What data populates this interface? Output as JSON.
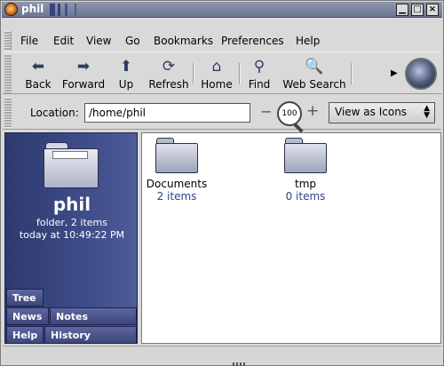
{
  "window": {
    "title": "phil"
  },
  "menu": {
    "items": [
      "File",
      "Edit",
      "View",
      "Go",
      "Bookmarks",
      "Preferences",
      "Help"
    ]
  },
  "toolbar": {
    "buttons": [
      {
        "label": "Back",
        "icon": "back-arrow-icon",
        "glyph": "⬅"
      },
      {
        "label": "Forward",
        "icon": "forward-arrow-icon",
        "glyph": "➡"
      },
      {
        "label": "Up",
        "icon": "up-arrow-icon",
        "glyph": "⬆"
      },
      {
        "label": "Refresh",
        "icon": "refresh-icon",
        "glyph": "⟳"
      },
      {
        "label": "Home",
        "icon": "home-icon",
        "glyph": "⌂"
      },
      {
        "label": "Find",
        "icon": "find-magnifier-icon",
        "glyph": "⚲"
      },
      {
        "label": "Web Search",
        "icon": "web-search-icon",
        "glyph": "🔍"
      }
    ]
  },
  "location": {
    "label": "Location:",
    "value": "/home/phil",
    "zoom": "100",
    "view_mode": "View as Icons"
  },
  "sidebar": {
    "name": "phil",
    "info_line1": "folder, 2 items",
    "info_line2": "today at 10:49:22 PM",
    "tabs": {
      "tree": "Tree",
      "news": "News",
      "notes": "Notes",
      "help": "Help",
      "history": "History"
    }
  },
  "content": {
    "items": [
      {
        "name": "Documents",
        "count": "2 items"
      },
      {
        "name": "tmp",
        "count": "0 items"
      }
    ]
  },
  "colors": {
    "sidebar": "#3e4c88",
    "titlebar": "#7c84a0",
    "item_count": "#33418a"
  }
}
